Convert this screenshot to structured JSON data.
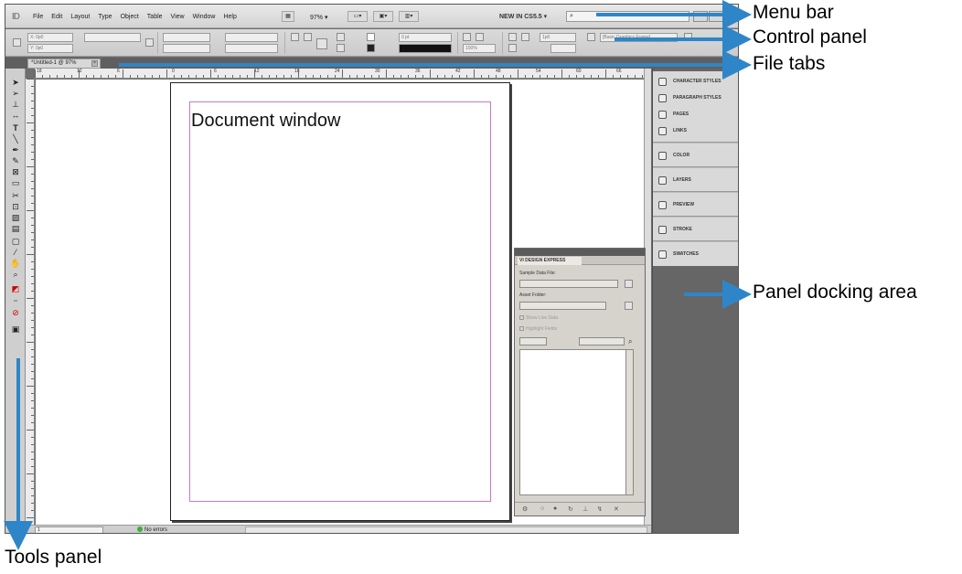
{
  "app": {
    "logo": "ID",
    "menus": [
      "File",
      "Edit",
      "Layout",
      "Type",
      "Object",
      "Table",
      "View",
      "Window",
      "Help"
    ],
    "zoom": "97%",
    "workspace": "NEW IN CS5.5",
    "search_icon": "search-icon"
  },
  "control": {
    "x_field": "X: 0p0",
    "y_field": "Y: 0p0",
    "stroke_weight": "0 pt",
    "opacity": "100%",
    "spacing": "1p0",
    "style": "[Basic Graphics Frame]"
  },
  "tabs": [
    {
      "label": "*Untitled-1 @ 97%"
    }
  ],
  "ruler": {
    "labels": [
      "18",
      "12",
      "6",
      "0",
      "6",
      "12",
      "18",
      "24",
      "30",
      "36",
      "42",
      "48",
      "54",
      "60",
      "66"
    ]
  },
  "document": {
    "label": "Document window"
  },
  "status": {
    "page": "1",
    "errors": "No errors"
  },
  "vi_panel": {
    "title": "VI DESIGN EXPRESS",
    "sample_label": "Sample Data File:",
    "asset_label": "Asset Folder:",
    "show_live": "Show Live Data",
    "highlight": "Highlight Fields"
  },
  "dock": {
    "items": [
      {
        "label": "CHARACTER STYLES",
        "icon": "character-styles-icon"
      },
      {
        "label": "PARAGRAPH STYLES",
        "icon": "paragraph-styles-icon"
      },
      {
        "label": "PAGES",
        "icon": "pages-icon"
      },
      {
        "label": "LINKS",
        "icon": "links-icon"
      },
      {
        "label": "COLOR",
        "icon": "color-icon"
      },
      {
        "label": "LAYERS",
        "icon": "layers-icon"
      },
      {
        "label": "PREVIEW",
        "icon": "preview-icon"
      },
      {
        "label": "STROKE",
        "icon": "stroke-icon"
      },
      {
        "label": "SWATCHES",
        "icon": "swatches-icon"
      }
    ]
  },
  "callouts": {
    "menu_bar": "Menu bar",
    "control_panel": "Control panel",
    "file_tabs": "File tabs",
    "panel_docking": "Panel docking area",
    "tools_panel": "Tools panel",
    "arrow_color": "#2e86c8"
  }
}
